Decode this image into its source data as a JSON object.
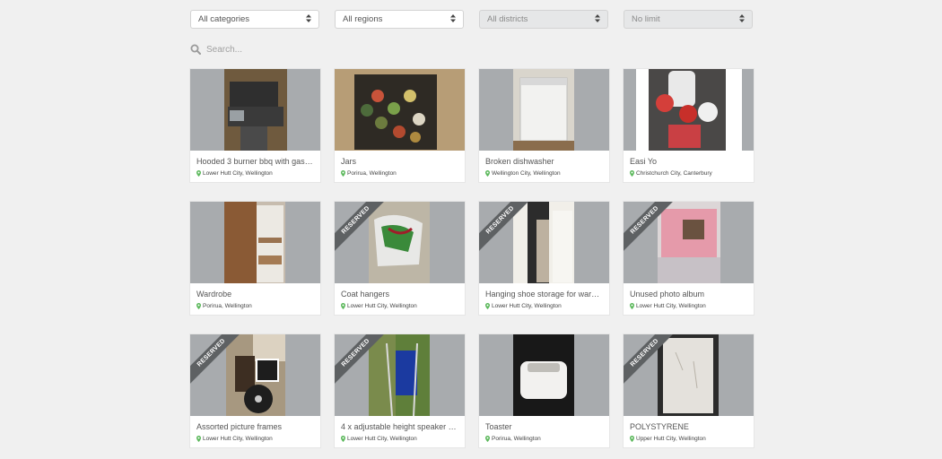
{
  "filters": {
    "category": "All categories",
    "region": "All regions",
    "district": "All districts",
    "limit": "No limit"
  },
  "search": {
    "placeholder": "Search..."
  },
  "ribbon_label": "RESERVED",
  "colors": {
    "pin": "#5cb85c",
    "ribbon": "#5e6163",
    "image_bg": "#a8abae"
  },
  "listings": [
    {
      "title": "Hooded 3 burner bbq with gas b...",
      "location": "Lower Hutt City, Wellington",
      "reserved": false
    },
    {
      "title": "Jars",
      "location": "Porirua, Wellington",
      "reserved": false
    },
    {
      "title": "Broken dishwasher",
      "location": "Wellington City, Wellington",
      "reserved": false
    },
    {
      "title": "Easi Yo",
      "location": "Christchurch City, Canterbury",
      "reserved": false
    },
    {
      "title": "Wardrobe",
      "location": "Porirua, Wellington",
      "reserved": false
    },
    {
      "title": "Coat hangers",
      "location": "Lower Hutt City, Wellington",
      "reserved": true
    },
    {
      "title": "Hanging shoe storage for wardr...",
      "location": "Lower Hutt City, Wellington",
      "reserved": true
    },
    {
      "title": "Unused photo album",
      "location": "Lower Hutt City, Wellington",
      "reserved": true
    },
    {
      "title": "Assorted picture frames",
      "location": "Lower Hutt City, Wellington",
      "reserved": true
    },
    {
      "title": "4 x adjustable height speaker st...",
      "location": "Lower Hutt City, Wellington",
      "reserved": true
    },
    {
      "title": "Toaster",
      "location": "Porirua, Wellington",
      "reserved": false
    },
    {
      "title": "POLYSTYRENE",
      "location": "Upper Hutt City, Wellington",
      "reserved": true
    }
  ]
}
